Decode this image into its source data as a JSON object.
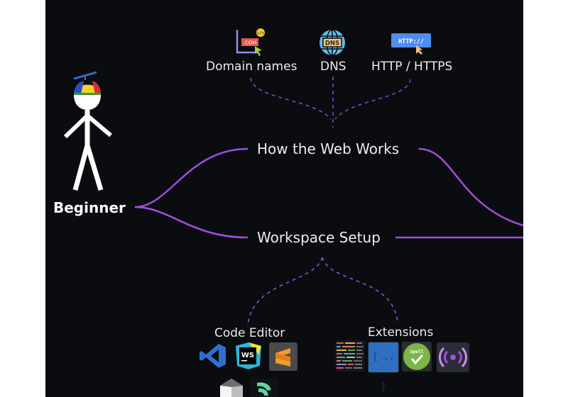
{
  "root": {
    "label": "Beginner",
    "figure": "stick-figure-with-propeller-cap"
  },
  "branches": [
    {
      "label": "How the Web Works",
      "children": [
        {
          "label": "Domain names",
          "icon": "domain-com-icon"
        },
        {
          "label": "DNS",
          "icon": "dns-globe-icon",
          "icon_text": "DNS"
        },
        {
          "label": "HTTP / HTTPS",
          "icon": "http-badge-icon",
          "icon_text": "HTTP://"
        }
      ]
    },
    {
      "label": "Workspace Setup",
      "children": [
        {
          "label": "Code Editor",
          "icons": [
            "vscode-icon",
            "webstorm-icon",
            "sublime-text-icon",
            "atom-like-prism-icon",
            "fleet-like-icon"
          ],
          "webstorm_text": "WS"
        },
        {
          "label": "Extensions",
          "icons": [
            "code-lines-icon",
            "brackets-icon",
            "spell-check-icon",
            "live-server-icon"
          ],
          "brackets_text": "{ .. }",
          "spell_text": "Spell"
        }
      ]
    }
  ],
  "domain_icon_text": ".COM",
  "colors": {
    "background": "#0b0c10",
    "connector": "#9b4de0",
    "dashed": "#7a4fd8",
    "text": "#ececec"
  }
}
